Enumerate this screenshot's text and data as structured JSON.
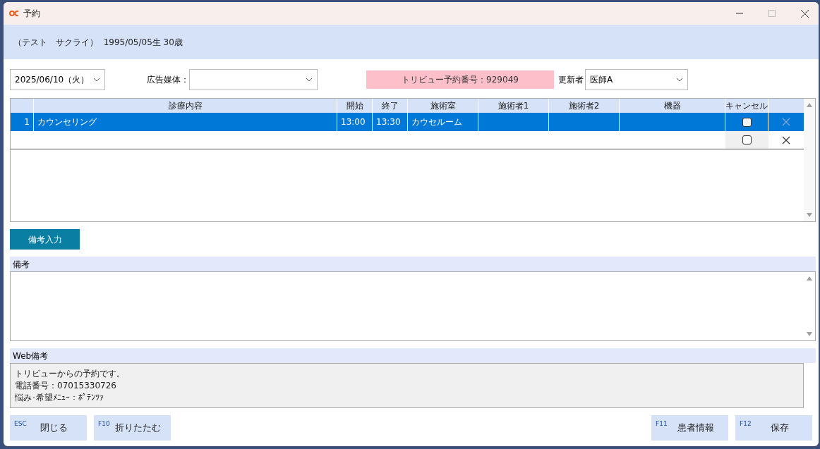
{
  "window": {
    "title": "予約"
  },
  "patient": {
    "info": "（テスト　サクライ）  1995/05/05生 30歳"
  },
  "date": {
    "value": "2025/06/10（火）"
  },
  "ad_media": {
    "label": "広告媒体："
  },
  "booking_number": "トリビュー予約番号：929049",
  "updater": {
    "label": "更新者",
    "value": "医師A"
  },
  "table": {
    "columns": [
      "診療内容",
      "開始",
      "終了",
      "施術室",
      "施術者1",
      "施術者2",
      "機器",
      "キャンセル"
    ],
    "rows": [
      {
        "number": "1",
        "content": "カウンセリング",
        "start": "13:00",
        "end": "13:30",
        "room": "カウセルーム",
        "cancelled": false,
        "selected": true
      },
      {
        "cancelled": false,
        "selected": false
      }
    ]
  },
  "note_button": "備考入力",
  "note": {
    "label": "備考"
  },
  "web_note": {
    "label": "Web備考",
    "lines": [
      "トリビューからの予約です。",
      "電話番号：07015330726",
      "悩み･希望ﾒﾆｭｰ：ﾎﾟﾃﾝﾂｧ"
    ]
  },
  "left_buttons": [
    {
      "key": "ESC",
      "label": "閉じる"
    },
    {
      "key": "F10",
      "label": "折りたたむ"
    }
  ],
  "right_buttons": [
    {
      "key": "F11",
      "label": "患者情報"
    },
    {
      "key": "F12",
      "label": "保存"
    }
  ]
}
